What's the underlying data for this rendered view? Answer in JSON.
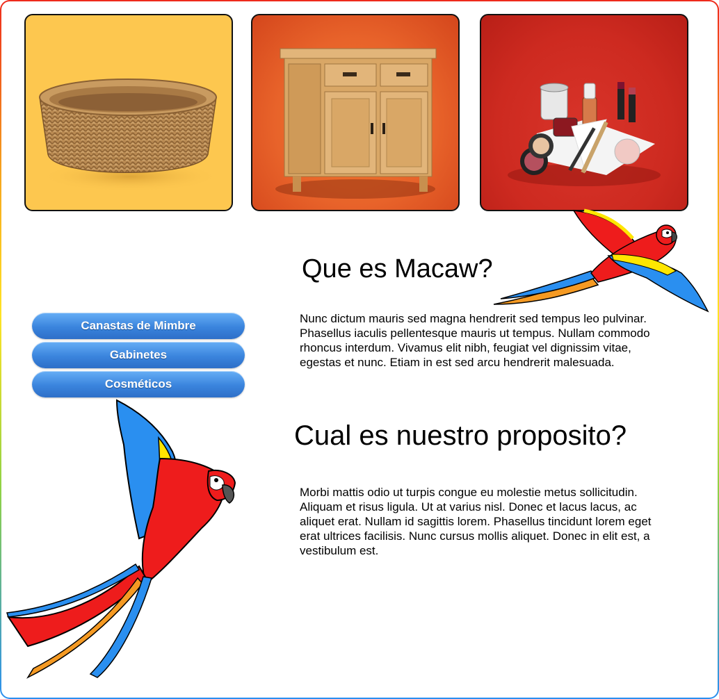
{
  "tiles": [
    {
      "name": "Canastas de Mimbre image",
      "color": "#fdc74f",
      "icon": "basket-image"
    },
    {
      "name": "Gabinetes image",
      "color": "#e8632a",
      "icon": "cabinet-image"
    },
    {
      "name": "Cosmeticos image",
      "color": "#cd2a20",
      "icon": "cosmetics-image"
    }
  ],
  "menu": {
    "items": [
      {
        "label": "Canastas de Mimbre"
      },
      {
        "label": "Gabinetes"
      },
      {
        "label": "Cosméticos"
      }
    ]
  },
  "sections": [
    {
      "title": "Que es Macaw?",
      "body": "Nunc dictum mauris sed magna hendrerit sed tempus leo pulvinar. Phasellus iaculis pellentesque mauris ut tempus. Nullam commodo rhoncus interdum. Vivamus elit nibh, feugiat vel dignissim vitae, egestas et nunc. Etiam in est sed arcu hendrerit malesuada."
    },
    {
      "title": "Cual es nuestro proposito?",
      "body": "Morbi mattis odio ut turpis congue eu molestie metus sollicitudin. Aliquam et risus ligula. Ut at varius nisl. Donec et lacus lacus, ac aliquet erat. Nullam id sagittis lorem. Phasellus tincidunt lorem eget erat ultrices facilisis. Nunc cursus mollis aliquet. Donec in elit est, a vestibulum est."
    }
  ],
  "colors": {
    "menu_button": "#3a84dd",
    "macaw_red": "#ee1c1c",
    "macaw_yellow": "#ffe600",
    "macaw_blue": "#2a8ff0",
    "macaw_orange": "#f59a23"
  }
}
